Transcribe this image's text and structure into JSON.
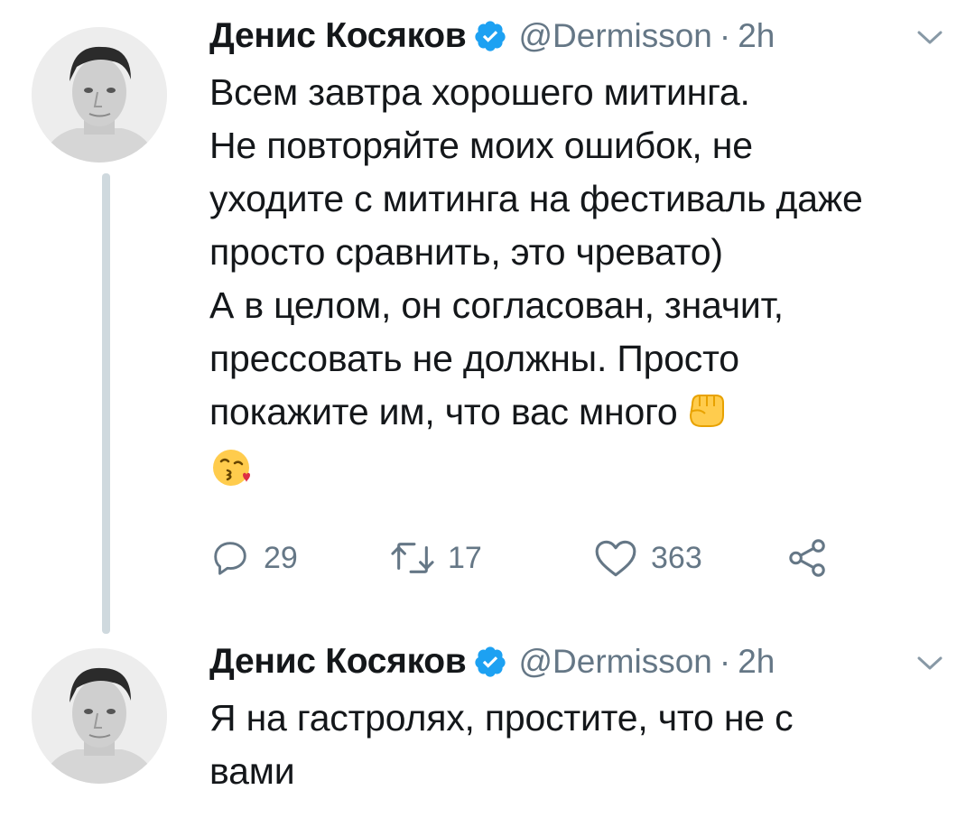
{
  "tweets": [
    {
      "author_name": "Денис Косяков",
      "handle": "@Dermisson",
      "separator": "·",
      "time": "2h",
      "lines": [
        "Всем завтра хорошего митинга.",
        "Не повторяйте моих ошибок, не",
        "уходите с митинга на фестиваль даже",
        "просто сравнить, это чревато)",
        "А в целом, он согласован, значит,",
        "прессовать не должны. Просто",
        "покажите им, что вас много"
      ],
      "emoji_inline": "raised-fist",
      "emoji_last_line": "face-blowing-a-kiss",
      "reply_count": "29",
      "retweet_count": "17",
      "like_count": "363"
    },
    {
      "author_name": "Денис Косяков",
      "handle": "@Dermisson",
      "separator": "·",
      "time": "2h",
      "lines": [
        "Я на гастролях, простите, что не с",
        "вами"
      ]
    }
  ],
  "colors": {
    "text": "#14171a",
    "secondary": "#657786",
    "verified": "#1da1f2",
    "thread_line": "#cfd9de"
  },
  "icons": {
    "reply": "reply-icon",
    "retweet": "retweet-icon",
    "like": "heart-icon",
    "share": "share-icon",
    "menu": "chevron-down-icon",
    "verified": "verified-badge-icon"
  }
}
